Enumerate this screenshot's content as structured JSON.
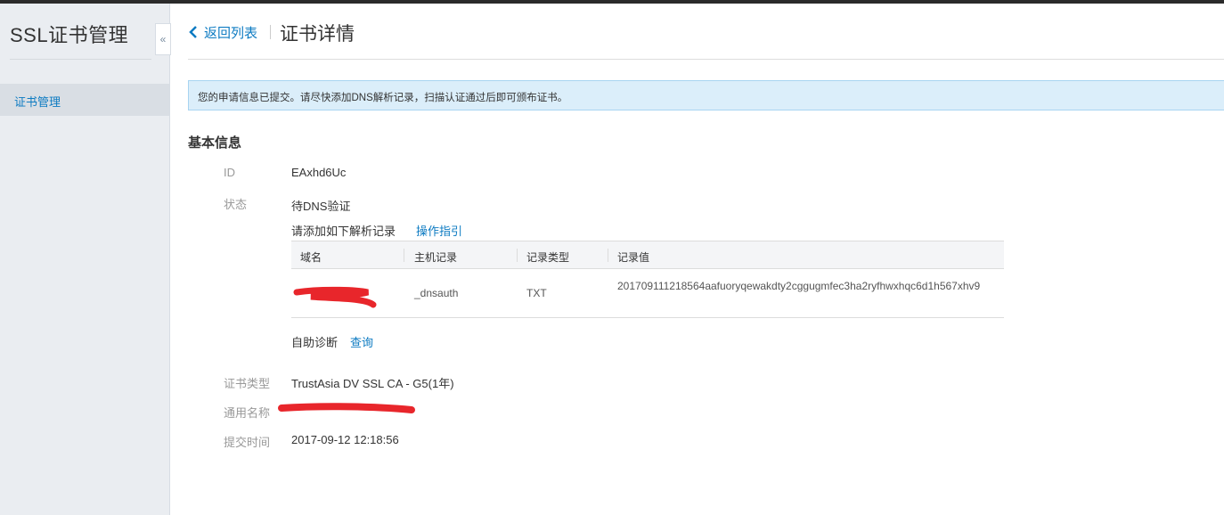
{
  "app": {
    "title": "SSL证书管理"
  },
  "sidebar": {
    "collapse_icon": "«",
    "items": [
      {
        "label": "证书管理",
        "active": true
      }
    ]
  },
  "header": {
    "back_label": "返回列表",
    "title": "证书详情"
  },
  "alert": {
    "message": "您的申请信息已提交。请尽快添加DNS解析记录，扫描认证通过后即可颁布证书。"
  },
  "basic_info": {
    "section_title": "基本信息",
    "id": {
      "label": "ID",
      "value": "EAxhd6Uc"
    },
    "status": {
      "label": "状态",
      "value": "待DNS验证",
      "instruction": "请添加如下解析记录",
      "guide_link": "操作指引"
    },
    "dns_table": {
      "columns": [
        "域名",
        "主机记录",
        "记录类型",
        "记录值"
      ],
      "rows": [
        {
          "domain": "",
          "host": "_dnsauth",
          "type": "TXT",
          "value": "201709111218564aafuoryqewakdty2cggugmfec3ha2ryfhwxhqc6d1h567xhv9"
        }
      ]
    },
    "diagnosis": {
      "label": "自助诊断",
      "link": "查询"
    },
    "cert_type": {
      "label": "证书类型",
      "value": "TrustAsia DV SSL CA - G5(1年)"
    },
    "common_name": {
      "label": "通用名称",
      "value": ""
    },
    "submit_time": {
      "label": "提交时间",
      "value": "2017-09-12 12:18:56"
    }
  },
  "colors": {
    "accent": "#0d7bc2",
    "sidebar_bg": "#eaedf1",
    "alert_bg": "#dbeefa",
    "redaction": "#e8262b"
  }
}
